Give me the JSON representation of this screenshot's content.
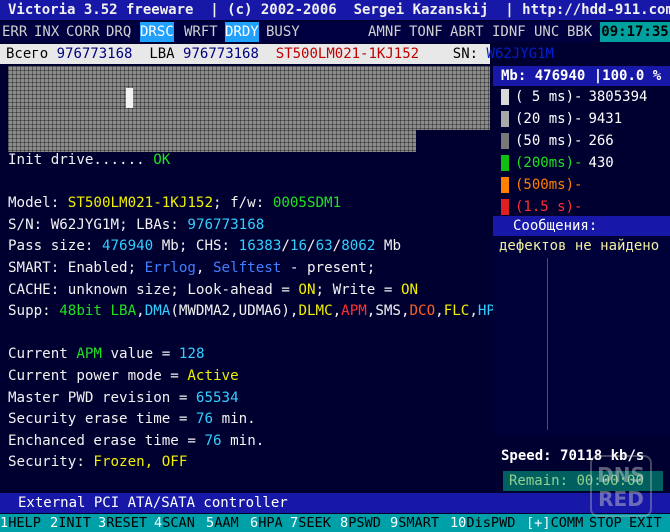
{
  "title_bar": {
    "text": "Victoria 3.52 freeware  | (c) 2002-2006  Sergei Kazanskij  | http://hdd-911.com"
  },
  "flags": {
    "items": [
      "ERR",
      "INX",
      "CORR",
      "DRQ",
      "DRSC",
      "WRFT",
      "DRDY",
      "BUSY",
      "AMNF",
      "TONF",
      "ABRT",
      "IDNF",
      "UNC",
      "BBK"
    ],
    "active": [
      "DRSC",
      "DRDY"
    ],
    "clock": "09:17:35"
  },
  "info": {
    "total_label": "Всего",
    "total_value": "976773168",
    "lba_label": "LBA",
    "lba_value": "976773168",
    "model": "ST500LM021-1KJ152",
    "sn_label": "SN:",
    "sn_value": "W62JYG1M"
  },
  "main": {
    "init_label": "Init drive......",
    "init_status": "OK",
    "model_label": "Model:",
    "model_value": "ST500LM021-1KJ152",
    "fw_label": "; f/w:",
    "fw_value": "0005SDM1",
    "sn_label": "S/N:",
    "sn_value": "W62JYG1M",
    "lbas_label": "; LBAs:",
    "lbas_value": "976773168",
    "pass_label": "Pass size:",
    "pass_value": "476940",
    "pass_unit": "Mb; CHS:",
    "chs_c": "16383",
    "chs_h": "16",
    "chs_s": "63",
    "chs_total": "8062",
    "chs_unit": "Mb",
    "smart_label": "SMART: Enabled;",
    "errlog": "Errlog",
    "selftest": "Selftest",
    "smart_tail": "- present;",
    "cache_text": "CACHE: unknown size; Look-ahead =",
    "cache_la": "ON",
    "cache_mid": "; Write =",
    "cache_wr": "ON",
    "supp_label": "Supp:",
    "supp_items": [
      {
        "text": "48bit LBA",
        "color": "#20e020"
      },
      {
        "text": "DMA",
        "color": "#30d0ff"
      },
      {
        "text": "(MWDMA2,UDMA6)",
        "color": "#f2f2f2"
      },
      {
        "text": "DLMC",
        "color": "#f0f000"
      },
      {
        "text": "APM",
        "color": "#ff3030"
      },
      {
        "text": "SMS",
        "color": "#f2f2f2"
      },
      {
        "text": "DCO",
        "color": "#ff6020"
      },
      {
        "text": "FLC",
        "color": "#f0f000"
      },
      {
        "text": "HPA",
        "color": "#30d0ff"
      }
    ],
    "apm_label_a": "Current",
    "apm_label_b": "APM",
    "apm_label_c": "value =",
    "apm_value": "128",
    "power_label": "Current power mode =",
    "power_value": "Active",
    "pwd_label": "Master PWD revision =",
    "pwd_value": "65534",
    "sec_erase_label": "Security erase time =",
    "sec_erase_value": "76",
    "sec_erase_unit": "min.",
    "enh_erase_label": "Enchanced erase time =",
    "enh_erase_value": "76",
    "enh_erase_unit": "min.",
    "security_label": "Security:",
    "security_frozen": "Frozen,",
    "security_off": "OFF"
  },
  "right": {
    "mb_label": "Mb:",
    "mb_value": "476940",
    "pct": "|100.0 %",
    "legend": [
      {
        "label": "( 5 ms)-",
        "value": "3805394",
        "color": "#d8d8d8",
        "text_color": "#ffffff"
      },
      {
        "label": "(20 ms)-",
        "value": "9431",
        "color": "#a8a8a8",
        "text_color": "#ffffff"
      },
      {
        "label": "(50 ms)-",
        "value": "266",
        "color": "#787878",
        "text_color": "#ffffff"
      },
      {
        "label": "(200ms)-",
        "value": "430",
        "color": "#10c010",
        "text_color": "#20e020"
      },
      {
        "label": "(500ms)-",
        "value": "",
        "color": "#ff8000",
        "text_color": "#ff8000"
      },
      {
        "label": "(1.5 s)-",
        "value": "",
        "color": "#e02020",
        "text_color": "#ff3030"
      }
    ],
    "msg_title": "Сообщения:",
    "msg_text": "дефектов не найдено",
    "speed_label": "Speed:",
    "speed_value": "70118 kb/s",
    "remain_label": "Remain:",
    "remain_value": "00:00:00"
  },
  "status_bar": {
    "text": "External PCI ATA/SATA controller"
  },
  "fkeys": [
    {
      "n": "1",
      "label": "HELP"
    },
    {
      "n": "2",
      "label": "INIT"
    },
    {
      "n": "3",
      "label": "RESET"
    },
    {
      "n": "4",
      "label": "SCAN"
    },
    {
      "n": "5",
      "label": "AAM"
    },
    {
      "n": "6",
      "label": "HPA"
    },
    {
      "n": "7",
      "label": "SEEK"
    },
    {
      "n": "8",
      "label": "PSWD"
    },
    {
      "n": "9",
      "label": "SMART"
    },
    {
      "n": "10",
      "label": "DisPWD"
    },
    {
      "n": "[+]",
      "label": "COMM"
    },
    {
      "n": "",
      "label": "STOP"
    },
    {
      "n": "",
      "label": "EXIT"
    }
  ],
  "watermark": "DNS RED"
}
